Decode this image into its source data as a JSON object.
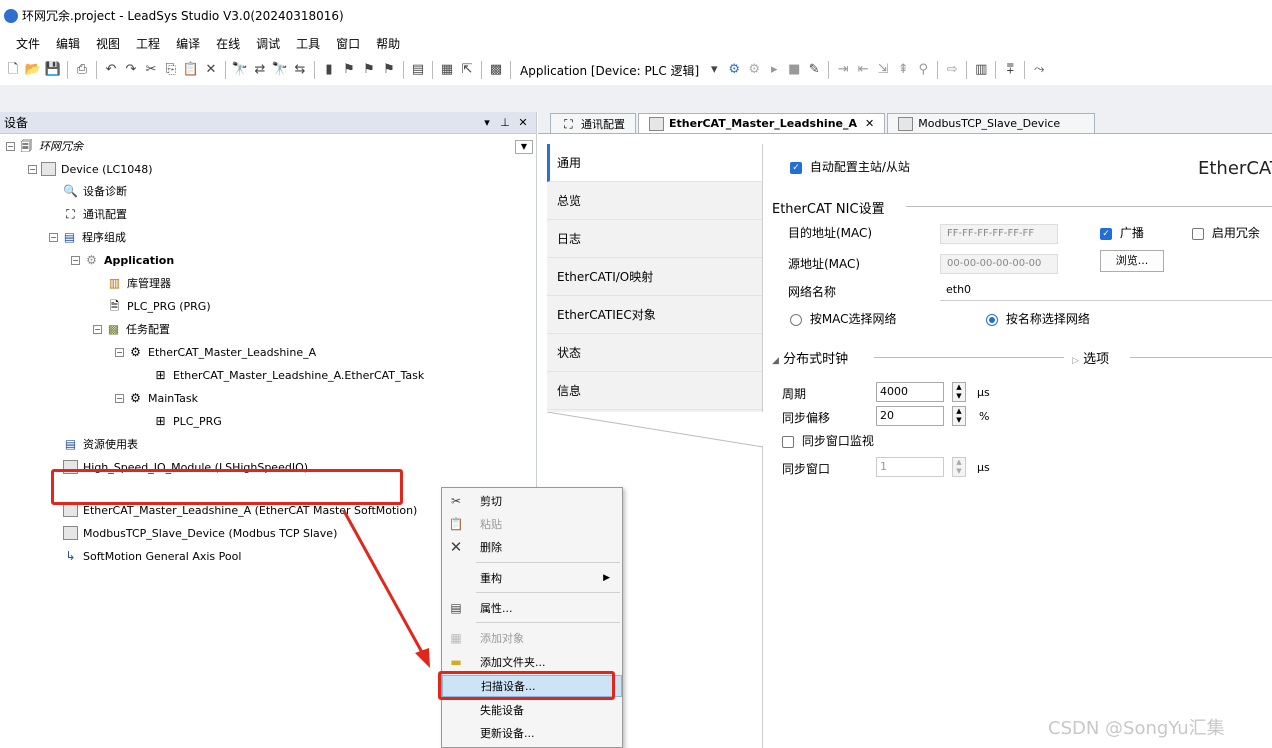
{
  "window": {
    "title": "环网冗余.project - LeadSys Studio V3.0(20240318016)"
  },
  "menu": [
    "文件",
    "编辑",
    "视图",
    "工程",
    "编译",
    "在线",
    "调试",
    "工具",
    "窗口",
    "帮助"
  ],
  "toolbar": {
    "application_label": "Application [Device: PLC 逻辑]"
  },
  "devices_panel": {
    "title": "设备",
    "tree": [
      {
        "label": "环网冗余",
        "icon": "project-icon"
      },
      {
        "label": "Device (LC1048)",
        "icon": "device-icon"
      },
      {
        "label": "设备诊断",
        "icon": "magnifier-icon"
      },
      {
        "label": "通讯配置",
        "icon": "network-icon"
      },
      {
        "label": "程序组成",
        "icon": "program-icon"
      },
      {
        "label": "Application",
        "icon": "gear-icon"
      },
      {
        "label": "库管理器",
        "icon": "library-icon"
      },
      {
        "label": "PLC_PRG (PRG)",
        "icon": "document-icon"
      },
      {
        "label": "任务配置",
        "icon": "task-config-icon"
      },
      {
        "label": "EtherCAT_Master_Leadshine_A",
        "icon": "task-icon"
      },
      {
        "label": "EtherCAT_Master_Leadshine_A.EtherCAT_Task",
        "icon": "call-icon"
      },
      {
        "label": "MainTask",
        "icon": "task-icon"
      },
      {
        "label": "PLC_PRG",
        "icon": "call-icon"
      },
      {
        "label": "资源使用表",
        "icon": "table-icon"
      },
      {
        "label": "High_Speed_IO_Module (LSHighSpeedIO)",
        "icon": "device-icon"
      },
      {
        "label": "EtherCAT_Master_Leadshine_A (EtherCAT Master SoftMotion)",
        "icon": "device-icon"
      },
      {
        "label": "ModbusTCP_Slave_Device (Modbus TCP Slave)",
        "icon": "device-icon"
      },
      {
        "label": "SoftMotion General Axis Pool",
        "icon": "axis-icon"
      }
    ]
  },
  "editor": {
    "tabs": [
      "通讯配置",
      "EtherCAT_Master_Leadshine_A",
      "ModbusTCP_Slave_Device"
    ],
    "active_tab": 1,
    "nav": [
      "通用",
      "总览",
      "日志",
      "EtherCATI/O映射",
      "EtherCATIEC对象",
      "状态",
      "信息"
    ],
    "auto_config_label": "自动配置主站/从站",
    "logo_text": "EtherCAT",
    "nic_section": "EtherCAT NIC设置",
    "dest_addr_label": "目的地址(MAC)",
    "dest_addr_value": "FF-FF-FF-FF-FF-FF",
    "broadcast_label": "广播",
    "redundancy_label": "启用冗余",
    "src_addr_label": "源地址(MAC)",
    "src_addr_value": "00-00-00-00-00-00",
    "browse_label": "浏览...",
    "net_name_label": "网络名称",
    "net_name_value": "eth0",
    "select_by_mac": "按MAC选择网络",
    "select_by_name": "按名称选择网络",
    "dc_section": "分布式时钟",
    "options_label": "选项",
    "cycle_label": "周期",
    "cycle_value": "4000",
    "cycle_unit": "μs",
    "sync_offset_label": "同步偏移",
    "sync_offset_value": "20",
    "sync_offset_unit": "%",
    "sync_window_monitor_label": "同步窗口监视",
    "sync_window_label": "同步窗口",
    "sync_window_value": "1",
    "sync_window_unit": "μs"
  },
  "context_menu": {
    "cut": "剪切",
    "paste": "粘贴",
    "delete": "删除",
    "refactor": "重构",
    "properties": "属性...",
    "add_object": "添加对象",
    "add_folder": "添加文件夹...",
    "scan_devices": "扫描设备...",
    "disable_device": "失能设备",
    "update_device": "更新设备..."
  },
  "watermark": "CSDN @SongYu汇集",
  "colors": {
    "accent": "#1f6fd6",
    "highlight_box": "#e1261c",
    "menu_highlight": "#cde4f7"
  }
}
